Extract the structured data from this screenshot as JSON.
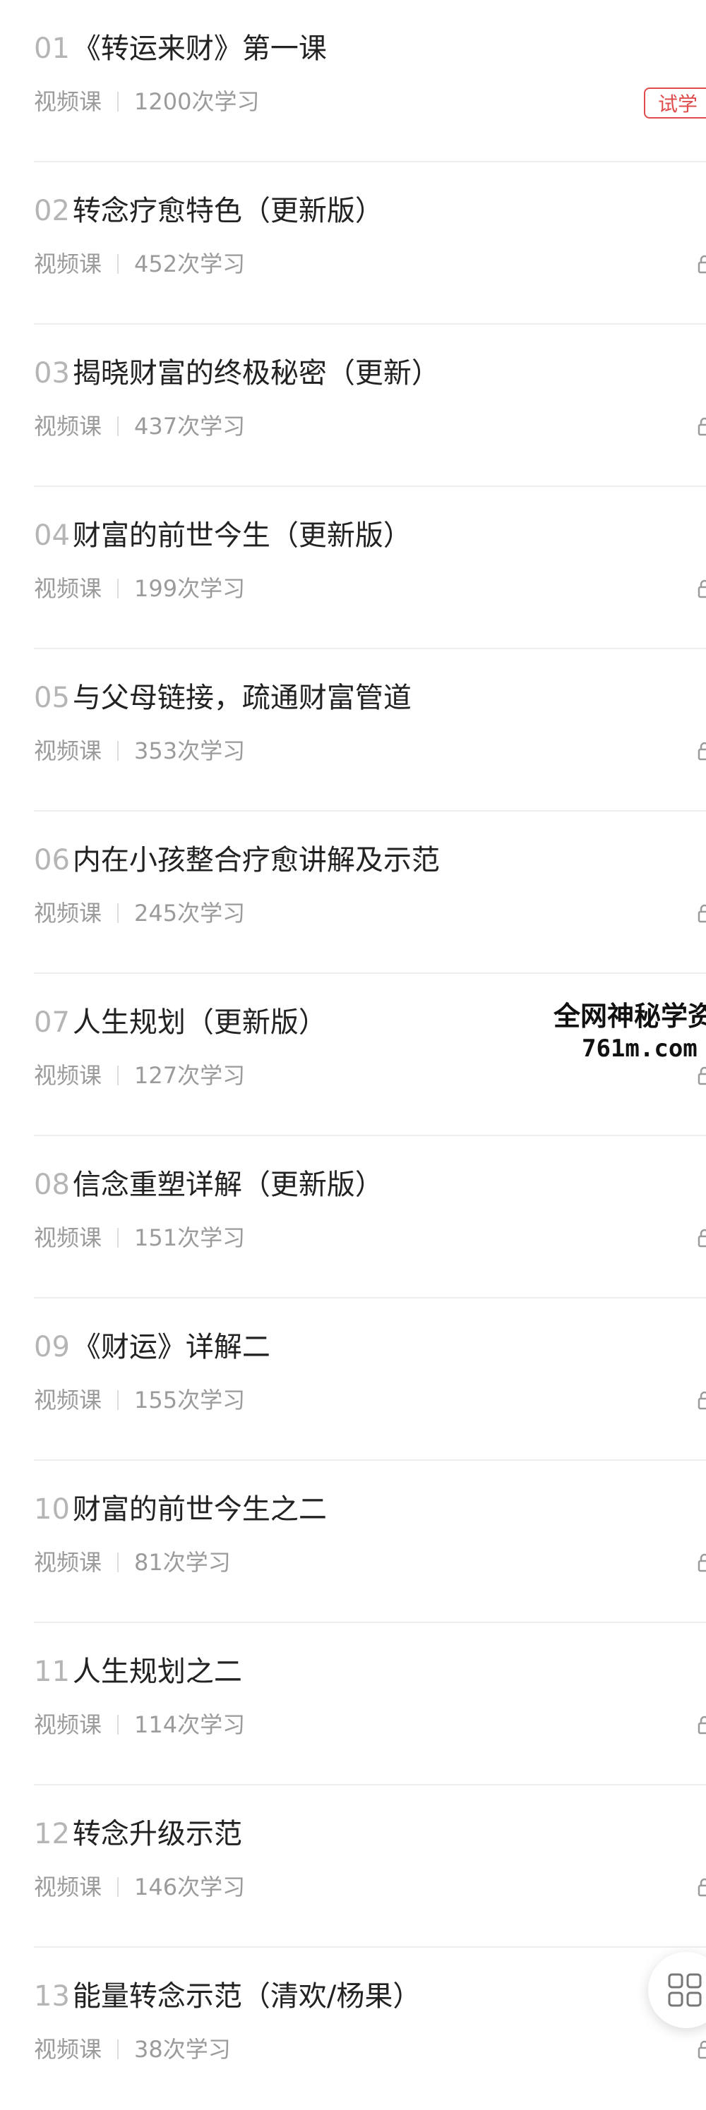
{
  "lessons": [
    {
      "num": "01",
      "title": "《转运来财》第一课",
      "type": "视频课",
      "views": "1200次学习",
      "badge": "试学"
    },
    {
      "num": "02",
      "title": "转念疗愈特色（更新版）",
      "type": "视频课",
      "views": "452次学习"
    },
    {
      "num": "03",
      "title": "揭晓财富的终极秘密（更新）",
      "type": "视频课",
      "views": "437次学习"
    },
    {
      "num": "04",
      "title": "财富的前世今生（更新版）",
      "type": "视频课",
      "views": "199次学习"
    },
    {
      "num": "05",
      "title": "与父母链接，疏通财富管道",
      "type": "视频课",
      "views": "353次学习"
    },
    {
      "num": "06",
      "title": "内在小孩整合疗愈讲解及示范",
      "type": "视频课",
      "views": "245次学习"
    },
    {
      "num": "07",
      "title": "人生规划（更新版）",
      "type": "视频课",
      "views": "127次学习"
    },
    {
      "num": "08",
      "title": "信念重塑详解（更新版）",
      "type": "视频课",
      "views": "151次学习"
    },
    {
      "num": "09",
      "title": "《财运》详解二",
      "type": "视频课",
      "views": "155次学习"
    },
    {
      "num": "10",
      "title": "财富的前世今生之二",
      "type": "视频课",
      "views": "81次学习"
    },
    {
      "num": "11",
      "title": "人生规划之二",
      "type": "视频课",
      "views": "114次学习"
    },
    {
      "num": "12",
      "title": "转念升级示范",
      "type": "视频课",
      "views": "146次学习"
    },
    {
      "num": "13",
      "title": "能量转念示范（清欢/杨果）",
      "type": "视频课",
      "views": "38次学习"
    }
  ],
  "watermark": {
    "line1": "全网神秘学资",
    "line2": "761m.com"
  },
  "colors": {
    "accent": "#e04b4b",
    "number": "#b5b5b5",
    "meta": "#9b9b9b",
    "title": "#222222"
  },
  "icons": {
    "lock": "lock-icon",
    "grid": "grid-menu-icon"
  }
}
